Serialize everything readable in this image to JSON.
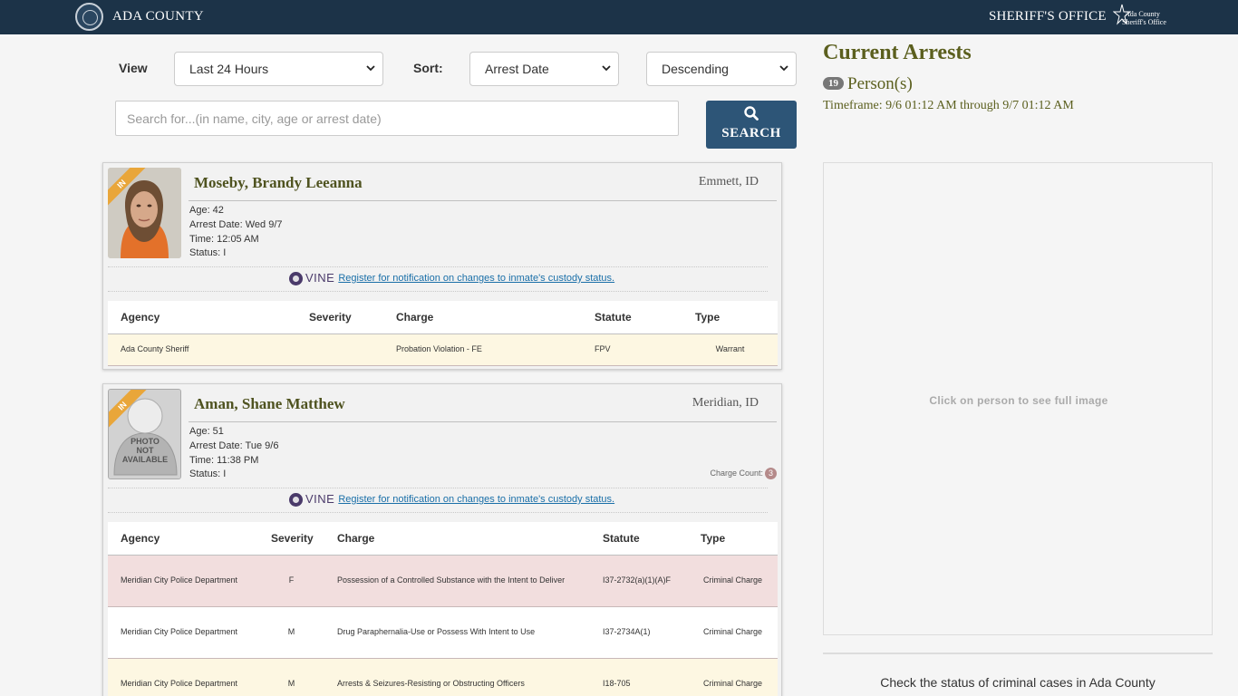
{
  "header": {
    "county_name": "ADA COUNTY",
    "office_name": "SHERIFF'S OFFICE",
    "badge_line1": "Ada County",
    "badge_line2": "Sheriff's Office"
  },
  "filters": {
    "view_label": "View",
    "view_value": "Last 24 Hours",
    "sort_label": "Sort:",
    "sort_value": "Arrest Date",
    "order_value": "Descending",
    "search_placeholder": "Search for...(in name, city, age or arrest date)",
    "search_button": "SEARCH"
  },
  "inmates": [
    {
      "ribbon": "IN",
      "name": "Moseby, Brandy Leeanna",
      "city": "Emmett, ID",
      "age": "Age: 42",
      "arrest_date": "Arrest Date: Wed 9/7",
      "time": "Time: 12:05 AM",
      "status": "Status: I",
      "vine_logo": "VINE",
      "vine_link": "Register for notification on changes to inmate's custody status.",
      "columns": [
        "Agency",
        "Severity",
        "Charge",
        "Statute",
        "Type"
      ],
      "charges": [
        {
          "agency": "Ada County Sheriff",
          "severity": "",
          "charge": "Probation Violation - FE",
          "statute": "FPV",
          "type": "Warrant"
        }
      ]
    },
    {
      "ribbon": "IN",
      "name": "Aman, Shane Matthew",
      "city": "Meridian, ID",
      "age": "Age: 51",
      "arrest_date": "Arrest Date: Tue 9/6",
      "time": "Time: 11:38 PM",
      "status": "Status: I",
      "photo_text": "PHOTO NOT AVAILABLE",
      "charge_count_label": "Charge Count:",
      "charge_count": "3",
      "vine_logo": "VINE",
      "vine_link": "Register for notification on changes to inmate's custody status.",
      "columns": [
        "Agency",
        "Severity",
        "Charge",
        "Statute",
        "Type"
      ],
      "charges": [
        {
          "agency": "Meridian City Police Department",
          "severity": "F",
          "charge": "Possession of a Controlled Substance with the Intent to Deliver",
          "statute": "I37-2732(a)(1)(A)F",
          "type": "Criminal Charge"
        },
        {
          "agency": "Meridian City Police Department",
          "severity": "M",
          "charge": "Drug Paraphernalia-Use or Possess With Intent to Use",
          "statute": "I37-2734A(1)",
          "type": "Criminal Charge"
        },
        {
          "agency": "Meridian City Police Department",
          "severity": "M",
          "charge": "Arrests & Seizures-Resisting or Obstructing Officers",
          "statute": "I18-705",
          "type": "Criminal Charge"
        }
      ]
    }
  ],
  "summary": {
    "title": "Current Arrests",
    "person_count": "19",
    "person_label": "Person(s)",
    "timeframe": "Timeframe: 9/6 01:12 AM through 9/7 01:12 AM",
    "image_hint": "Click on person to see full image",
    "cases_link": "Check the status of criminal cases in Ada County"
  },
  "colors": {
    "header_bg": "#1c3348",
    "title_olive": "#5b5f1e",
    "button_blue": "#2d5577",
    "ribbon_orange": "#e9a63a",
    "felony_row": "#f2dede",
    "alt_row": "#fdf7e2"
  }
}
